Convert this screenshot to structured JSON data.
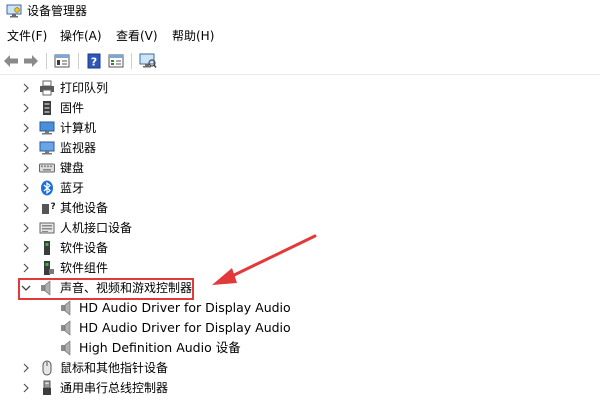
{
  "window": {
    "title": "设备管理器"
  },
  "menu": [
    "文件(F)",
    "操作(A)",
    "查看(V)",
    "帮助(H)"
  ],
  "toolbar_icons": [
    "back-arrow-icon",
    "forward-arrow-icon",
    "properties-icon",
    "help-icon",
    "details-icon",
    "monitor-scan-icon"
  ],
  "tree": {
    "categories_before": [
      {
        "label": "打印队列",
        "icon": "printer-icon"
      },
      {
        "label": "固件",
        "icon": "firmware-icon"
      },
      {
        "label": "计算机",
        "icon": "computer-icon"
      },
      {
        "label": "监视器",
        "icon": "monitor-icon"
      },
      {
        "label": "键盘",
        "icon": "keyboard-icon"
      },
      {
        "label": "蓝牙",
        "icon": "bluetooth-icon"
      },
      {
        "label": "其他设备",
        "icon": "unknown-device-icon"
      },
      {
        "label": "人机接口设备",
        "icon": "hid-icon"
      },
      {
        "label": "软件设备",
        "icon": "software-device-icon"
      },
      {
        "label": "软件组件",
        "icon": "software-component-icon"
      }
    ],
    "expanded": {
      "label": "声音、视频和游戏控制器",
      "icon": "speaker-icon"
    },
    "children": [
      {
        "label": "HD Audio Driver for Display Audio",
        "icon": "speaker-icon"
      },
      {
        "label": "HD Audio Driver for Display Audio",
        "icon": "speaker-icon"
      },
      {
        "label": "High Definition Audio 设备",
        "icon": "speaker-icon"
      }
    ],
    "categories_after": [
      {
        "label": "鼠标和其他指针设备",
        "icon": "mouse-icon"
      },
      {
        "label": "通用串行总线控制器",
        "icon": "usb-icon"
      }
    ]
  },
  "colors": {
    "highlight": "#e23a3a",
    "arrow": "#e23a3a"
  }
}
